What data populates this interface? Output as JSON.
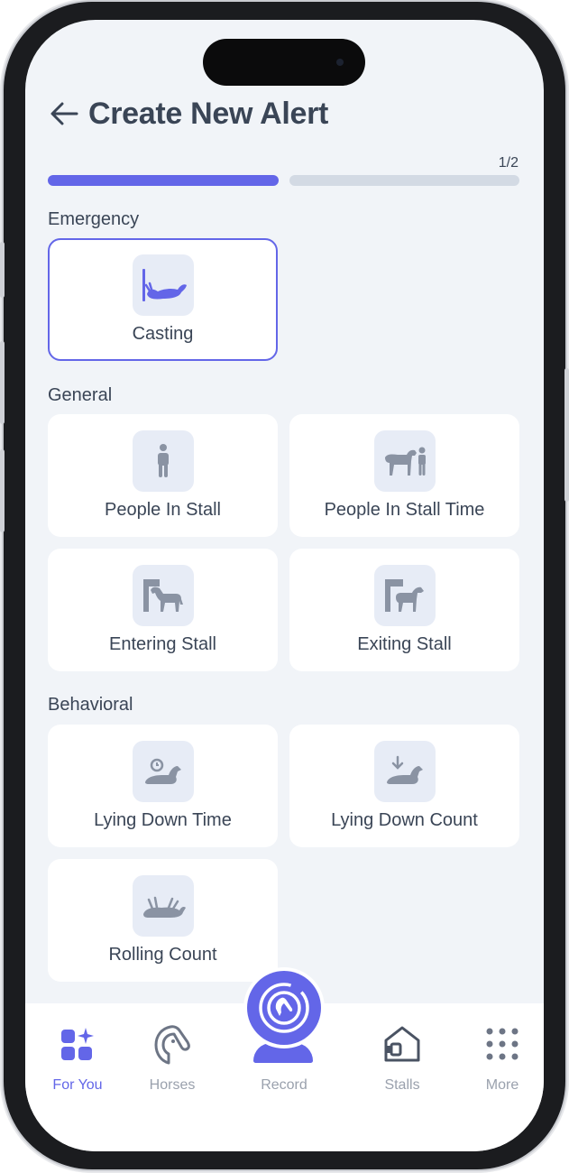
{
  "header": {
    "title": "Create New Alert"
  },
  "progress": {
    "step_text": "1/2",
    "completed_fraction": 0.5,
    "active_color": "#6366e8",
    "inactive_color": "#d3dae4"
  },
  "sections": {
    "emergency": {
      "label": "Emergency",
      "items": [
        {
          "label": "Casting",
          "icon": "horse-casting-icon",
          "selected": true
        }
      ]
    },
    "general": {
      "label": "General",
      "items": [
        {
          "label": "People In Stall",
          "icon": "person-icon"
        },
        {
          "label": "People In Stall Time",
          "icon": "horse-with-person-icon"
        },
        {
          "label": "Entering Stall",
          "icon": "horse-entering-stall-icon"
        },
        {
          "label": "Exiting Stall",
          "icon": "horse-exiting-stall-icon"
        }
      ]
    },
    "behavioral": {
      "label": "Behavioral",
      "items": [
        {
          "label": "Lying Down Time",
          "icon": "horse-lying-time-icon"
        },
        {
          "label": "Lying Down Count",
          "icon": "horse-lying-count-icon"
        },
        {
          "label": "Rolling Count",
          "icon": "horse-rolling-icon"
        }
      ]
    }
  },
  "tabbar": {
    "for_you": "For You",
    "horses": "Horses",
    "record": "Record",
    "stalls": "Stalls",
    "more": "More",
    "active": "for_you"
  },
  "colors": {
    "accent": "#6366e8",
    "text": "#3a4556",
    "icon_gray": "#8a93a3",
    "background": "#f1f4f8"
  }
}
